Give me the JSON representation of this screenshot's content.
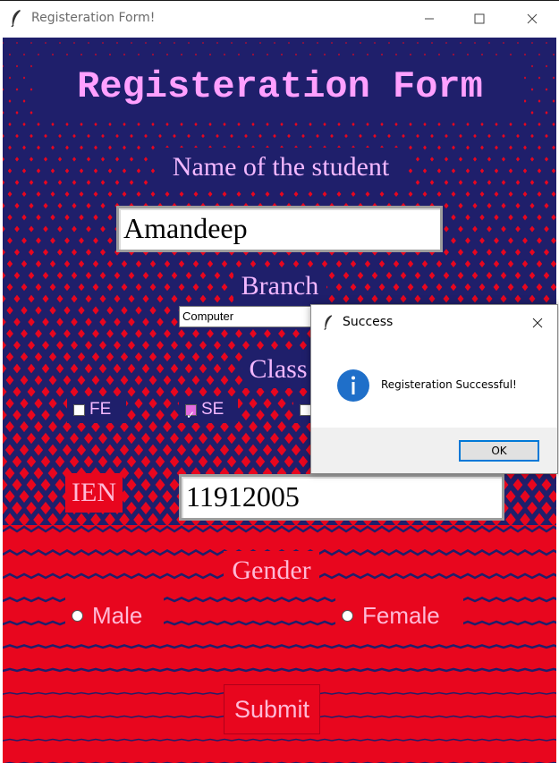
{
  "window": {
    "title": "Registeration Form!",
    "controls": [
      "minimize",
      "maximize",
      "close"
    ]
  },
  "form": {
    "heading": "Registeration Form",
    "name_label": "Name of the student",
    "name_value": "Amandeep",
    "branch_label": "Branch",
    "branch_value": "Computer",
    "class_label": "Class",
    "class_options": [
      {
        "label": "FE",
        "checked": false
      },
      {
        "label": "SE",
        "checked": true
      },
      {
        "label": "",
        "checked": false
      }
    ],
    "ien_label": "IEN",
    "ien_value": "11912005",
    "gender_label": "Gender",
    "gender_options": [
      {
        "label": "Male",
        "selected": false
      },
      {
        "label": "Female",
        "selected": false
      }
    ],
    "submit_label": "Submit"
  },
  "dialog": {
    "title": "Success",
    "message": "Registeration Successful!",
    "ok_label": "OK",
    "icon": "info-icon"
  },
  "colors": {
    "navy": "#1f1f6b",
    "red": "#e8061e",
    "heading_text": "#ffa0ff",
    "accent_blue": "#0078d7"
  }
}
